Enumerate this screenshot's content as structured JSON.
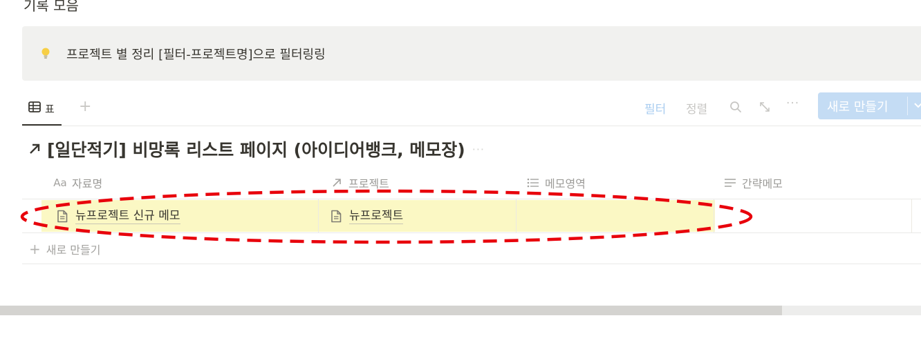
{
  "page": {
    "heading": "기록 모음"
  },
  "callout": {
    "icon": "lightbulb-icon",
    "text": "프로젝트 별 정리 [필터-프로젝트명]으로 필터링링"
  },
  "view_bar": {
    "tab_label": "표",
    "add_view": "+",
    "filter": "필터",
    "sort": "정렬",
    "new_button": "새로 만들기",
    "more": "···"
  },
  "database": {
    "title": "[일단적기] 비망록 리스트 페이지 (아이디어뱅크, 메모장)",
    "title_more": "···",
    "columns": [
      {
        "label": "자료명",
        "icon": "Aa"
      },
      {
        "label": "프로젝트",
        "icon": "relation-arrow-icon"
      },
      {
        "label": "메모영역",
        "icon": "list-icon"
      },
      {
        "label": "간략메모",
        "icon": "text-lines-icon"
      }
    ],
    "rows": [
      {
        "name": "뉴프로젝트 신규 메모",
        "project": "뉴프로젝트",
        "memo_area": "",
        "brief": ""
      }
    ],
    "new_row": "새로 만들기"
  },
  "colors": {
    "accent": "#2383e2",
    "highlight": "#fbf8c4",
    "annotation_red": "#e8000b",
    "callout_bg": "#f1f1ef"
  }
}
